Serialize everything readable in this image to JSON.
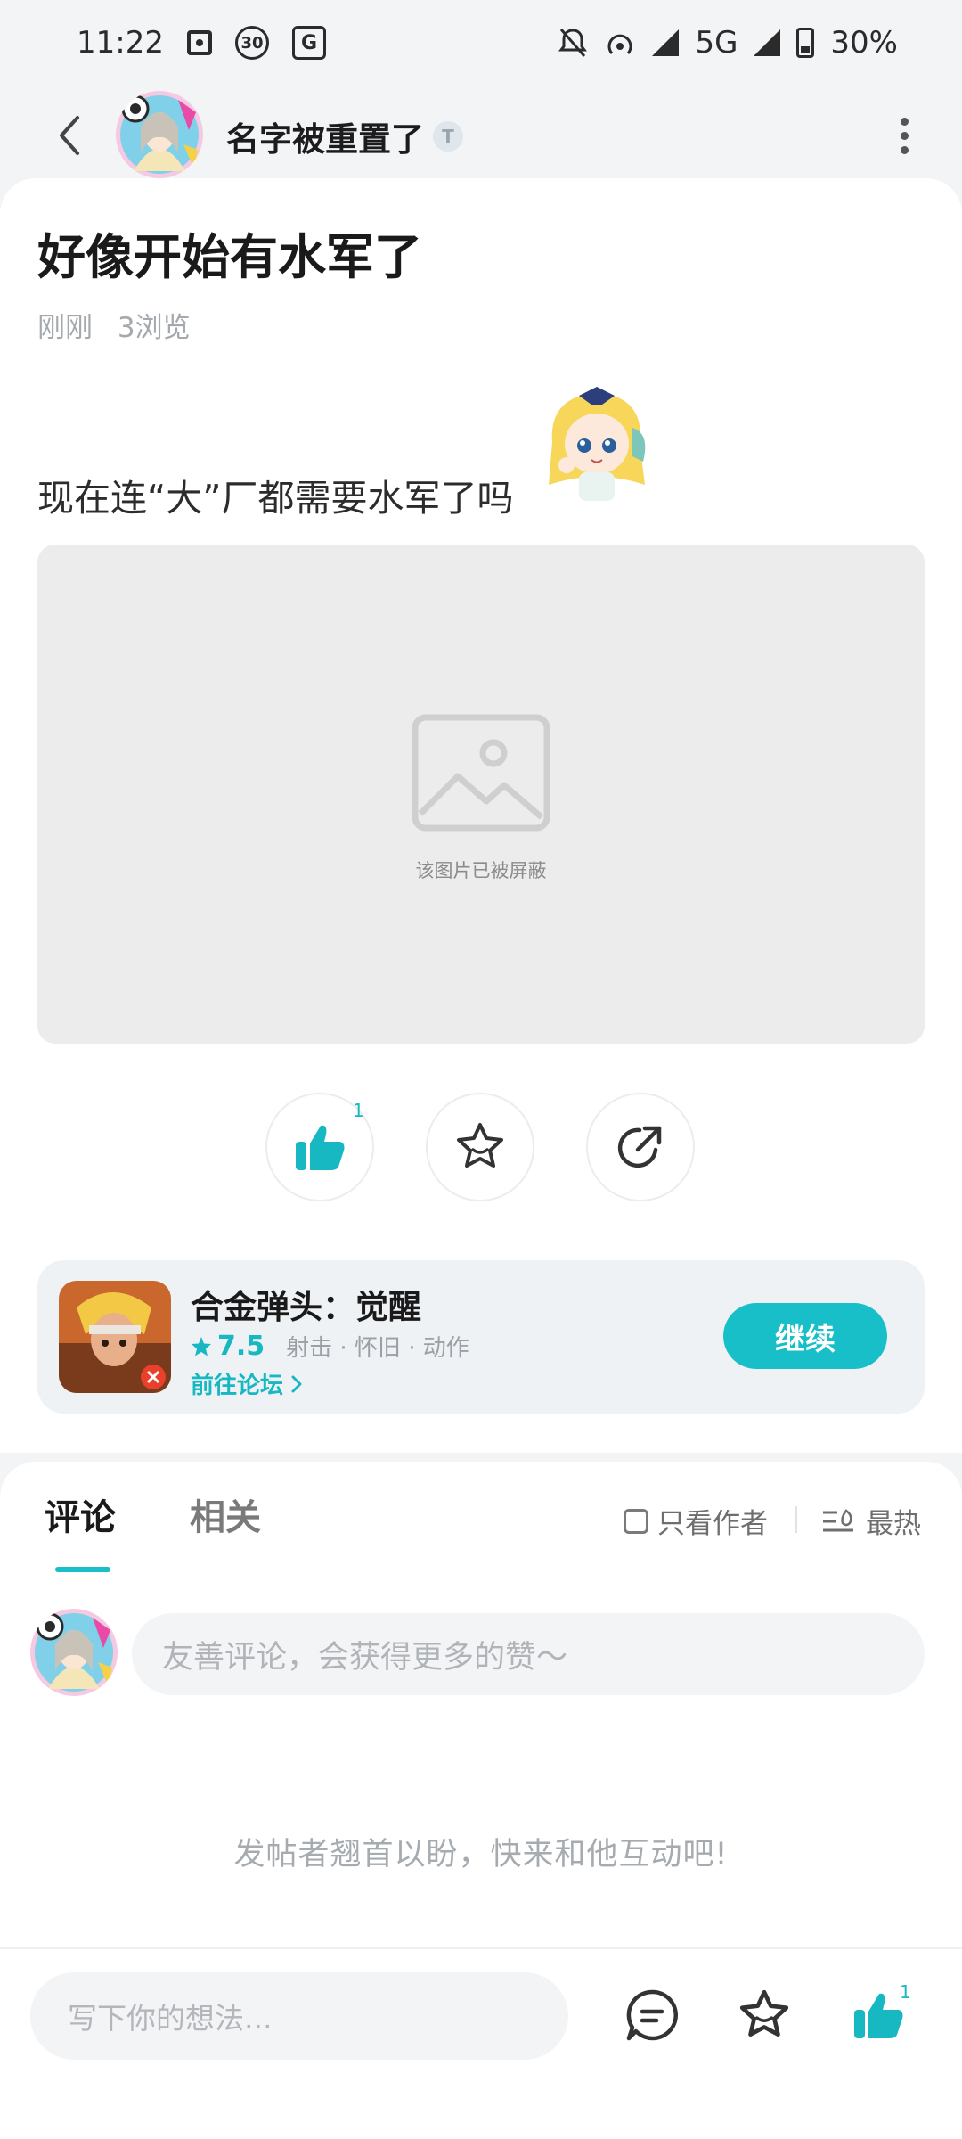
{
  "status_bar": {
    "time": "11:22",
    "network": "5G",
    "battery": "30%",
    "icons": [
      "screen-record-icon",
      "30-badge-icon",
      "translate-icon",
      "bell-off-icon",
      "hotspot-icon",
      "signal-icon",
      "battery-charging-icon"
    ]
  },
  "header": {
    "author_name": "名字被重置了",
    "badge": "T"
  },
  "post": {
    "title": "好像开始有水军了",
    "time": "刚刚",
    "views": "3浏览",
    "body": "现在连“大”厂都需要水军了吗",
    "image_blocked_text": "该图片已被屏蔽",
    "like_count": "1"
  },
  "game": {
    "name": "合金弹头：觉醒",
    "score": "7.5",
    "tags": "射击 · 怀旧 · 动作",
    "forum_link": "前往论坛",
    "button": "继续"
  },
  "comments": {
    "tabs": [
      "评论",
      "相关"
    ],
    "only_author": "只看作者",
    "sort": "最热",
    "input_placeholder": "友善评论，会获得更多的赞～",
    "empty_hint": "发帖者翘首以盼，快来和他互动吧!"
  },
  "bottom_bar": {
    "input_placeholder": "写下你的想法...",
    "like_count": "1"
  },
  "colors": {
    "accent": "#19bfc8",
    "background": "#f2f4f6",
    "card": "#ffffff"
  }
}
